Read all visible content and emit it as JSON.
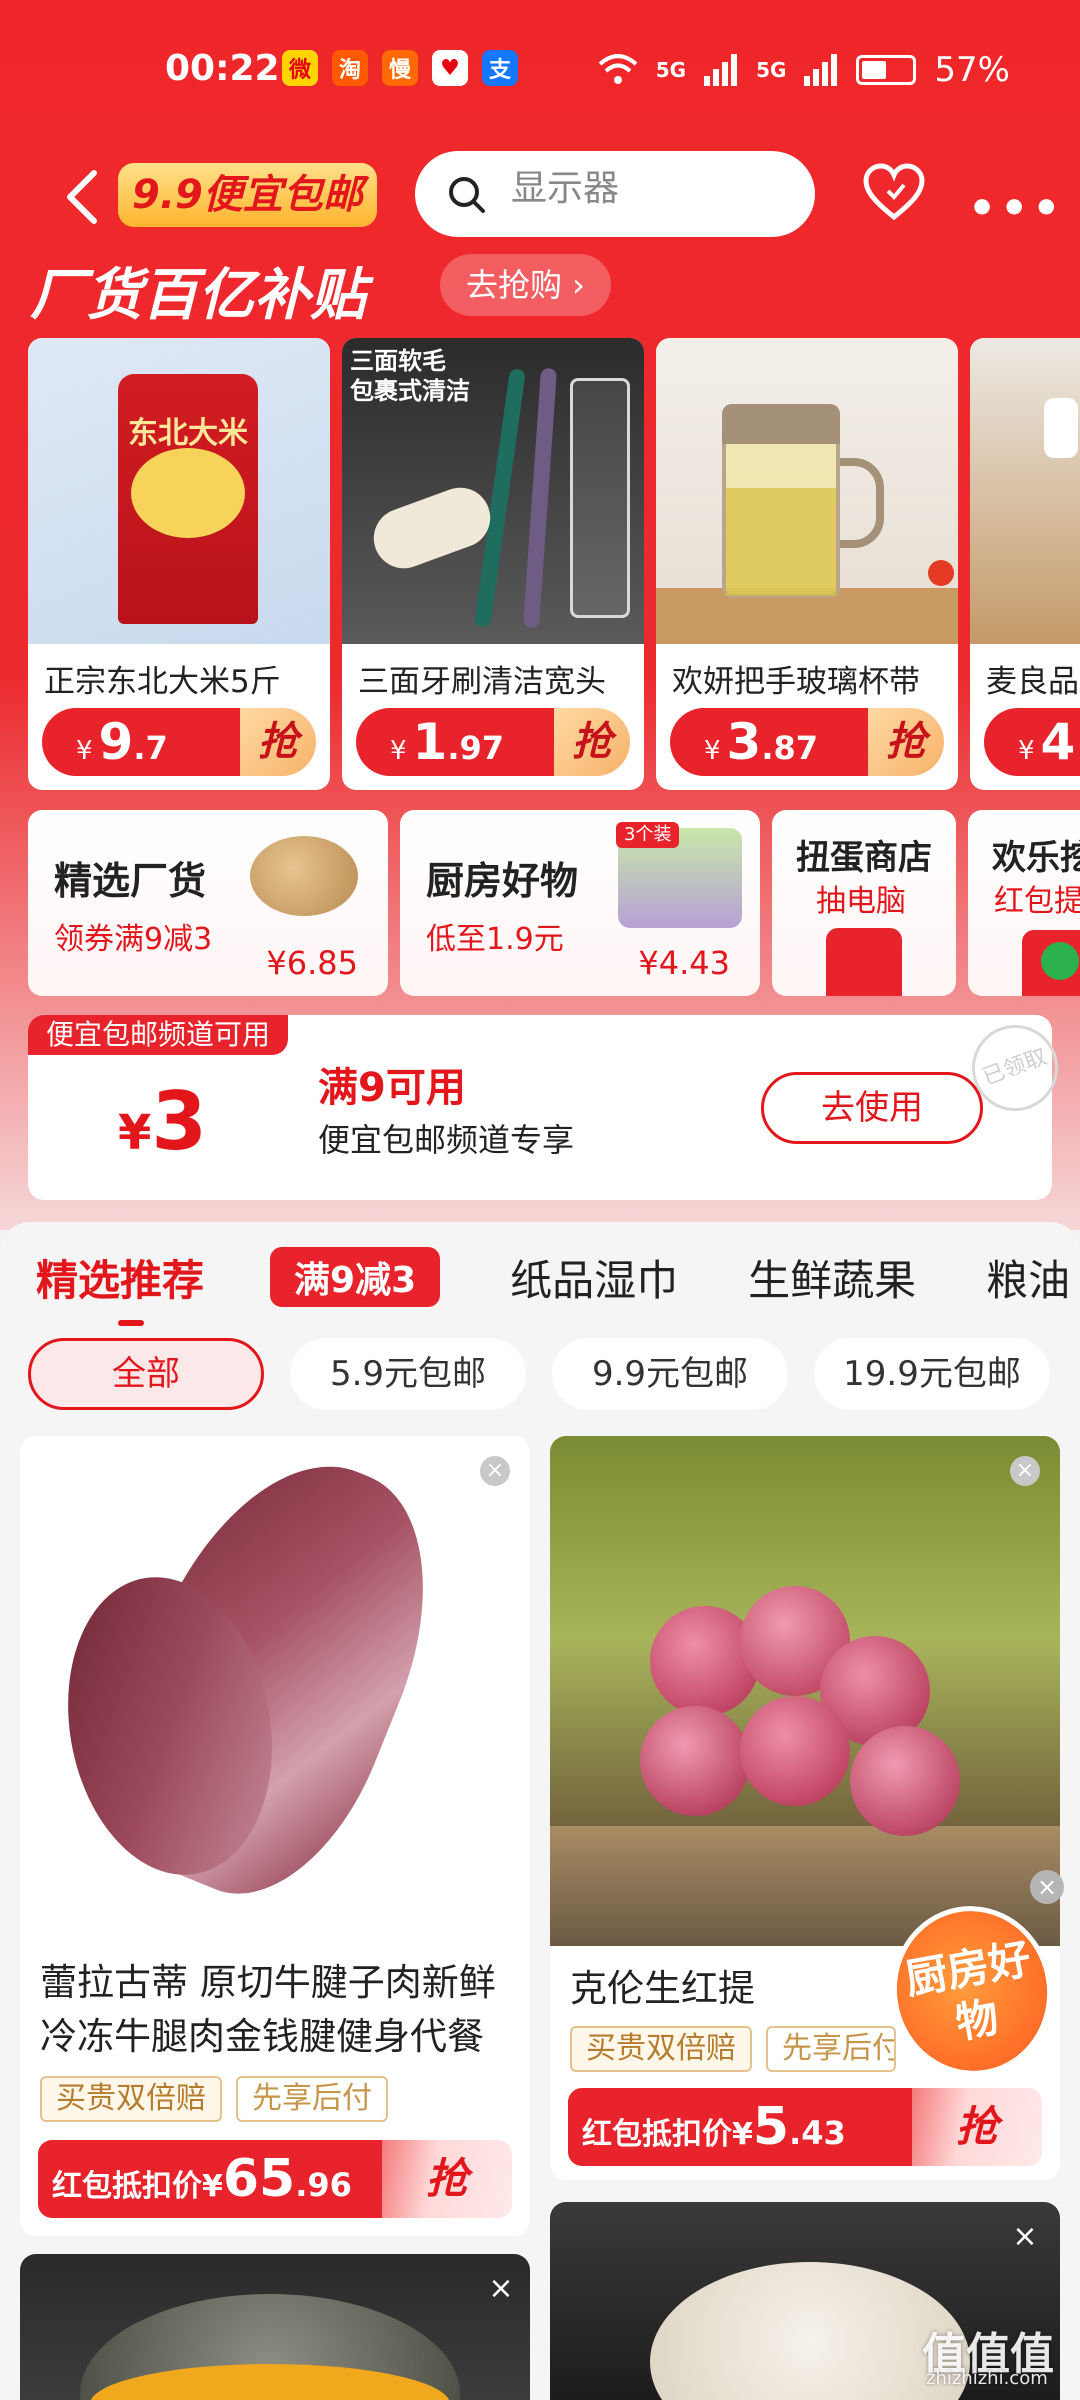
{
  "status_bar": {
    "time": "00:22",
    "apps": [
      {
        "icon": "weibo-icon",
        "glyph": "微",
        "bg": "#ffd400",
        "fg": "#e60012"
      },
      {
        "icon": "taobao-icon",
        "glyph": "淘",
        "bg": "#ff5a00",
        "fg": "#ffffff"
      },
      {
        "icon": "man-icon",
        "glyph": "慢",
        "bg": "#ff6a00",
        "fg": "#ffffff"
      },
      {
        "icon": "redapp-icon",
        "glyph": "♥",
        "bg": "#ffffff",
        "fg": "#e60012"
      },
      {
        "icon": "alipay-icon",
        "glyph": "支",
        "bg": "#1677ff",
        "fg": "#ffffff"
      }
    ],
    "network1": "5G",
    "network2": "5G",
    "battery": "57%"
  },
  "nav": {
    "logo": "9.9便宜包邮",
    "search_placeholder": "显示器"
  },
  "banner": {
    "title": "厂货百亿补贴",
    "link": "去抢购 ›"
  },
  "products": [
    {
      "name": "正宗东北大米5斤",
      "currency": "¥",
      "int": "9",
      "dec": ".7",
      "cta": "抢"
    },
    {
      "name": "三面牙刷清洁宽头",
      "currency": "¥",
      "int": "1",
      "dec": ".97",
      "cta": "抢",
      "img_text": "三面软毛\n包裹式清洁"
    },
    {
      "name": "欢妍把手玻璃杯带",
      "currency": "¥",
      "int": "3",
      "dec": ".87",
      "cta": "抢"
    },
    {
      "name": "麦良品",
      "currency": "¥",
      "int": "4",
      "dec": "",
      "cta": "抢"
    }
  ],
  "rice_bag_text": "东北大米",
  "chips": [
    {
      "title": "精选厂货",
      "sub": "领券满9减3",
      "price": "¥6.85"
    },
    {
      "title": "厨房好物",
      "sub": "低至1.9元",
      "price": "¥4.43",
      "badge": "3个装"
    },
    {
      "title": "扭蛋商店",
      "sub": "抽电脑"
    },
    {
      "title": "欢乐挖",
      "sub": "红包提"
    }
  ],
  "coupon": {
    "tag": "便宜包邮频道可用",
    "currency": "¥",
    "amount": "3",
    "title": "满9可用",
    "desc": "便宜包邮频道专享",
    "button": "去使用",
    "stamp": "已领取"
  },
  "tabs": [
    "精选推荐",
    "满9减3",
    "纸品湿巾",
    "生鲜蔬果",
    "粮油"
  ],
  "filters": [
    "全部",
    "5.9元包邮",
    "9.9元包邮",
    "19.9元包邮"
  ],
  "feed": [
    {
      "title": "蕾拉古蒂 原切牛腱子肉新鲜冷冻牛腿肉金钱腱健身代餐",
      "tags": [
        "买贵双倍赔",
        "先享后付"
      ],
      "price_label": "红包抵扣价¥",
      "int": "65",
      "dec": ".96",
      "cta": "抢"
    },
    {
      "title": "克伦生红提",
      "tags": [
        "买贵双倍赔",
        "先享后付"
      ],
      "price_label": "红包抵扣价¥",
      "int": "5",
      "dec": ".43",
      "cta": "抢"
    }
  ],
  "float_badge": "厨房好物",
  "watermark": {
    "text": "值值值",
    "url": "zhizhizhi.com"
  },
  "colors": {
    "brand_red": "#e8232b",
    "accent_gold": "#ffb52e"
  }
}
